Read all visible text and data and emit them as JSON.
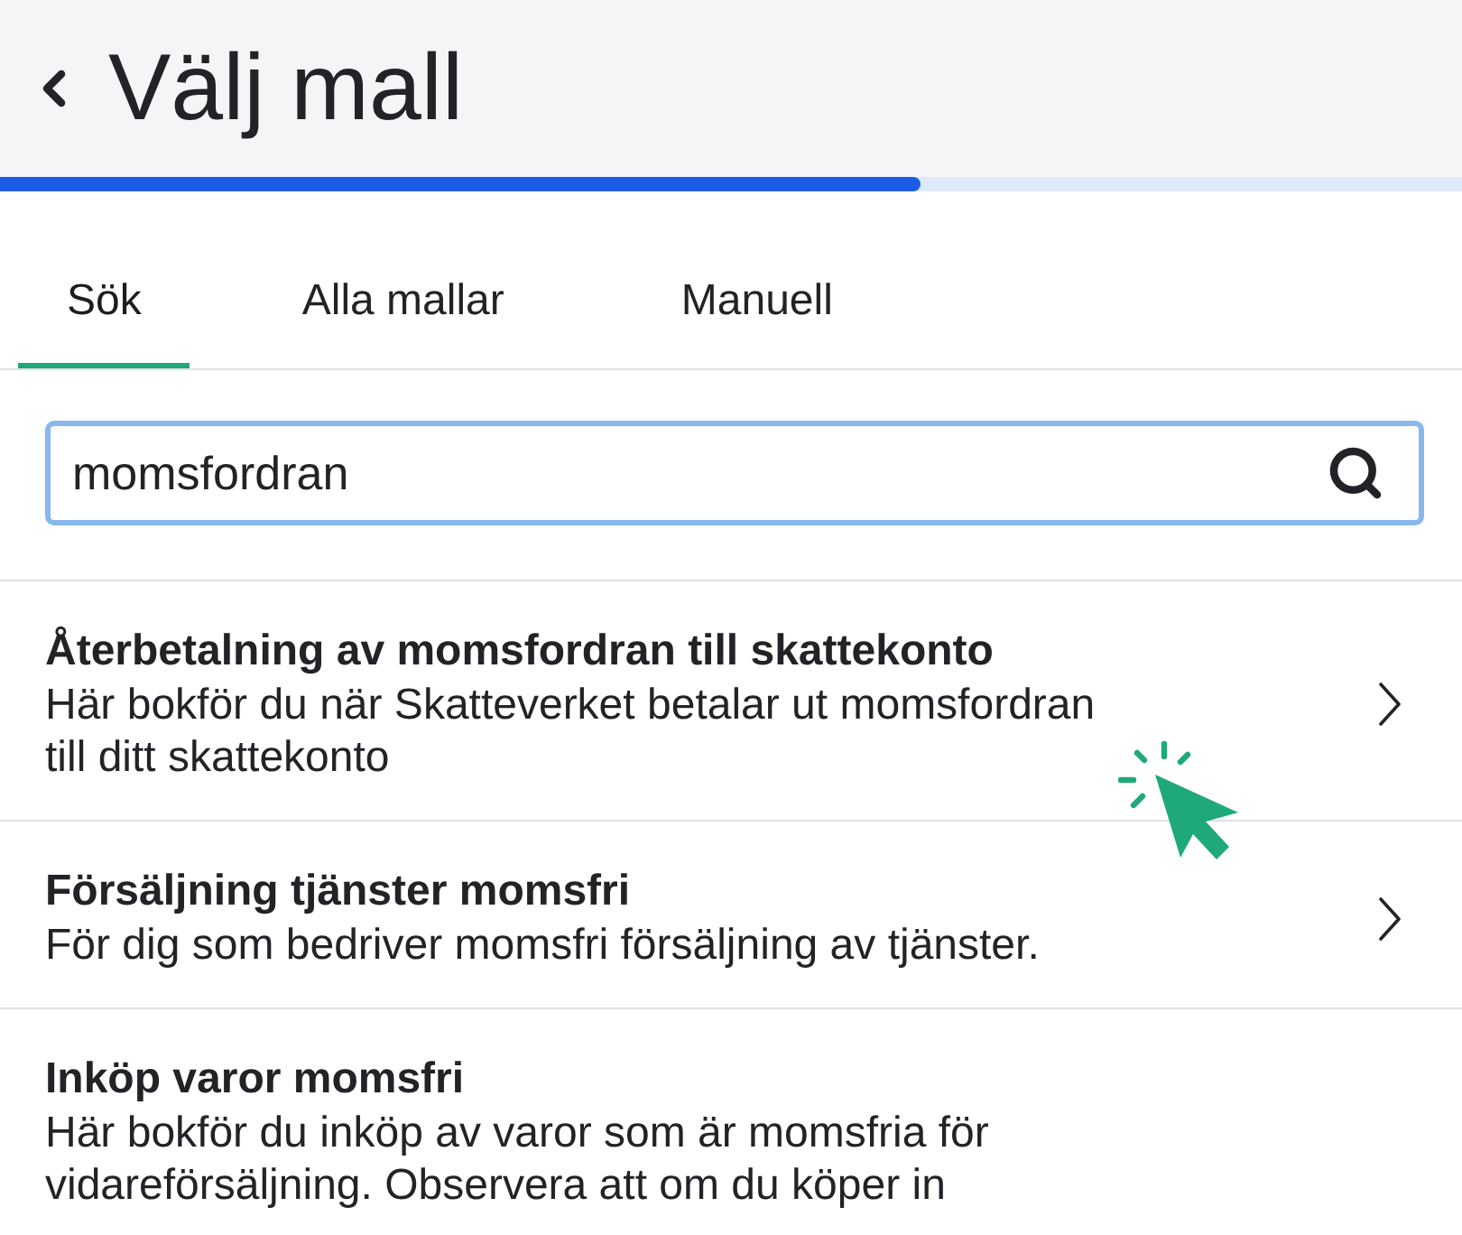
{
  "header": {
    "title": "Välj mall",
    "progress": {
      "level": 0.63
    }
  },
  "tabs": [
    {
      "label": "Sök",
      "selected": true
    },
    {
      "label": "Alla mallar",
      "selected": false
    },
    {
      "label": "Manuell",
      "selected": false
    }
  ],
  "search": {
    "value": "momsfordran"
  },
  "templates": [
    {
      "title": "Återbetalning av momsfordran till skattekonto",
      "description": "Här bokför du när Skatteverket betalar ut momsfordran till ditt skattekonto",
      "chevron": true
    },
    {
      "title": "Försäljning tjänster momsfri",
      "description": "För dig som bedriver momsfri försäljning av tjänster.",
      "chevron": true
    },
    {
      "title": "Inköp varor momsfri",
      "description": "Här bokför du inköp av varor som är momsfria för vidareförsäljning. Observera att om du köper in",
      "chevron": false
    }
  ]
}
